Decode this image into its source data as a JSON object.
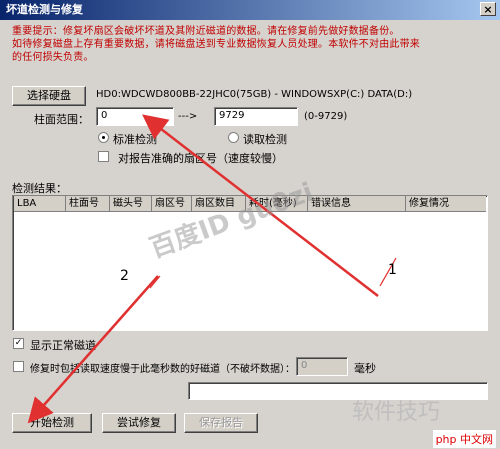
{
  "window": {
    "title": "坏道检测与修复",
    "close_label": "×"
  },
  "notice": {
    "lines": [
      "重要提示：修复坏扇区会破坏坏道及其附近磁道的数据。请在修复前先做好数据备份。",
      "如待修复磁盘上存有重要数据，请将磁盘送到专业数据恢复人员处理。本软件不对由此带来",
      "的任何损失负责。"
    ]
  },
  "disk": {
    "select_label": "选择硬盘",
    "info": "HD0:WDCWD800BB-22JHC0(75GB) - WINDOWSXP(C:) DATA(D:)"
  },
  "range": {
    "label": "柱面范围：",
    "start": "0",
    "arrow": "--->",
    "end": "9729",
    "hint": "(0-9729)"
  },
  "mode": {
    "standard_label": "标准检测",
    "read_label": "读取检测",
    "selected": "standard"
  },
  "accurate_option": {
    "label": "对报告准确的扇区号（速度较慢）"
  },
  "results": {
    "label": "检测结果：",
    "columns": [
      "LBA",
      "柱面号",
      "磁头号",
      "扇区号",
      "扇区数目",
      "耗时(毫秒)",
      "错误信息",
      "修复情况"
    ],
    "rows": []
  },
  "show_normal": {
    "label": "显示正常磁道",
    "checked": true
  },
  "repair_option": {
    "label": "修复时包括读取速度慢于此毫秒数的好磁道（不破坏数据）：",
    "value": "0",
    "unit": "毫秒"
  },
  "buttons": {
    "start": "开始检测",
    "try_repair": "尝试修复",
    "save_report": "保存报告"
  },
  "overlay": {
    "watermark": "百度ID gu0zi",
    "annotation_1": "1",
    "annotation_2": "2",
    "brand": "软件技巧",
    "site": "php 中文网"
  },
  "colors": {
    "title_start": "#08246b",
    "title_end": "#a5c7ef",
    "notice": "#c00000",
    "arrow": "#e03030"
  }
}
